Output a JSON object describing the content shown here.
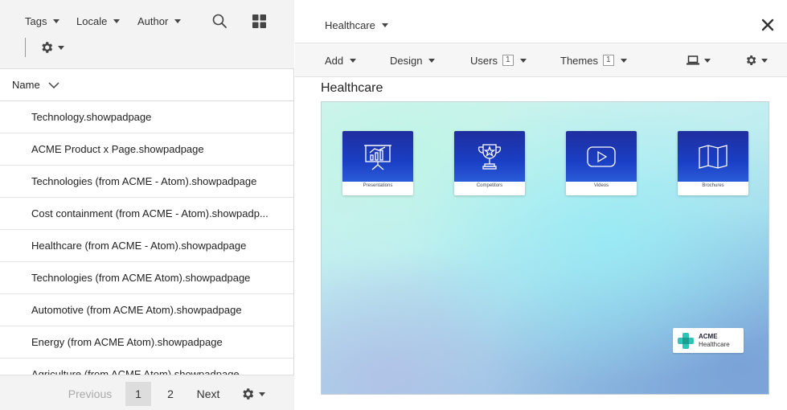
{
  "filters": {
    "tags": "Tags",
    "locale": "Locale",
    "author": "Author"
  },
  "list": {
    "header": "Name",
    "items": [
      "Technology.showpadpage",
      "ACME Product x Page.showpadpage",
      "Technologies (from ACME - Atom).showpadpage",
      "Cost containment (from ACME - Atom).showpadp...",
      "Healthcare (from ACME - Atom).showpadpage",
      "Technologies (from ACME Atom).showpadpage",
      "Automotive (from ACME Atom).showpadpage",
      "Energy (from ACME Atom).showpadpage",
      "Agriculture (from ACME Atom).showpadpage"
    ]
  },
  "pagination": {
    "previous": "Previous",
    "pages": [
      "1",
      "2"
    ],
    "current": "1",
    "next": "Next"
  },
  "editor": {
    "section": "Healthcare",
    "toolbar": {
      "add": "Add",
      "design": "Design",
      "users": "Users",
      "users_count": "1",
      "themes": "Themes",
      "themes_count": "1"
    },
    "page_title": "Healthcare",
    "tiles": [
      "Presentations",
      "Competitors",
      "Videos",
      "Brochures"
    ],
    "brand": {
      "line1": "ACME",
      "line2": "Healthcare"
    }
  },
  "colors": {
    "tile_blue": "#1a3fc4",
    "brand_teal": "#2ec4b6"
  },
  "icons": {
    "search": "search-icon",
    "grid": "grid-icon",
    "settings": "gear-icon",
    "close": "close-icon",
    "device": "laptop-icon"
  }
}
